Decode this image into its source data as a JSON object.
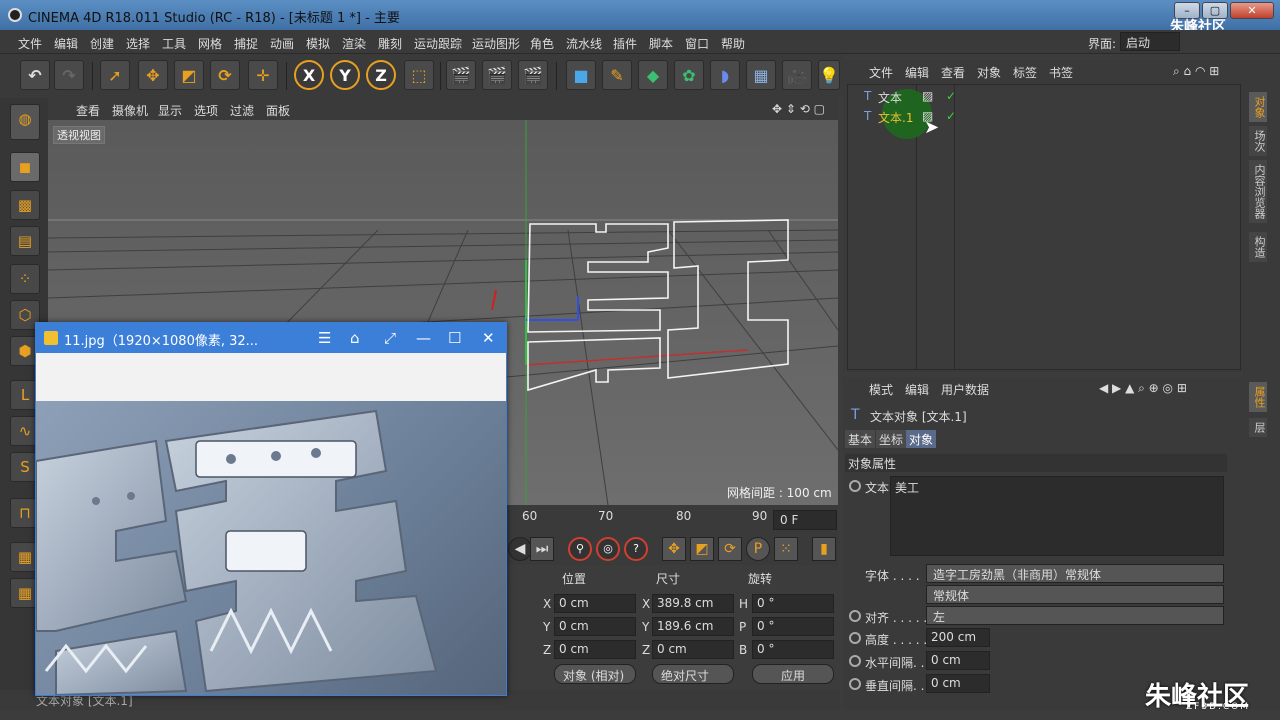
{
  "window": {
    "title": "CINEMA 4D R18.011 Studio (RC - R18) - [未标题 1 *] - 主要",
    "min": "–",
    "max": "▢",
    "close": "✕"
  },
  "menu": [
    "文件",
    "编辑",
    "创建",
    "选择",
    "工具",
    "网格",
    "捕捉",
    "动画",
    "模拟",
    "渲染",
    "雕刻",
    "运动跟踪",
    "运动图形",
    "角色",
    "流水线",
    "插件",
    "脚本",
    "窗口",
    "帮助"
  ],
  "layout": {
    "label": "界面:",
    "value": "启动"
  },
  "toolbar": {
    "x": "X",
    "y": "Y",
    "z": "Z"
  },
  "viewport": {
    "menu": [
      "查看",
      "摄像机",
      "显示",
      "选项",
      "过滤",
      "面板"
    ],
    "label": "透视视图",
    "grid_spacing": "网格间距 : 100 cm"
  },
  "timeline": {
    "ticks": [
      "60",
      "70",
      "80",
      "90"
    ],
    "frame": "0 F"
  },
  "coords": {
    "headers": {
      "pos": "位置",
      "size": "尺寸",
      "rot": "旋转"
    },
    "rows": [
      {
        "a": "X",
        "pos": "0 cm",
        "b": "X",
        "size": "389.8 cm",
        "c": "H",
        "rot": "0 °"
      },
      {
        "a": "Y",
        "pos": "0 cm",
        "b": "Y",
        "size": "189.6 cm",
        "c": "P",
        "rot": "0 °"
      },
      {
        "a": "Z",
        "pos": "0 cm",
        "b": "Z",
        "size": "0 cm",
        "c": "B",
        "rot": "0 °"
      }
    ],
    "mode": "对象 (相对)",
    "size_mode": "绝对尺寸",
    "apply": "应用"
  },
  "status": "文本对象 [文本.1]",
  "objects": {
    "menu": [
      "文件",
      "编辑",
      "查看",
      "对象",
      "标签",
      "书签"
    ],
    "items": [
      {
        "name": "文本",
        "check": "✓"
      },
      {
        "name": "文本.1",
        "check": "✓"
      }
    ]
  },
  "attributes": {
    "menu": [
      "模式",
      "编辑",
      "用户数据"
    ],
    "object_title": "文本对象 [文本.1]",
    "tabs": [
      "基本",
      "坐标",
      "对象"
    ],
    "section": "对象属性",
    "text_label": "文本",
    "text_value": "美工",
    "font_label": "字体 . . . .",
    "font_value": "造字工房劲黑（非商用）常规体",
    "font_style": "常规体",
    "align_label": "对齐 . . . . .",
    "align_value": "左",
    "height_label": "高度 . . . . .",
    "height_value": "200 cm",
    "hspace_label": "水平间隔. .",
    "hspace_value": "0 cm",
    "vspace_label": "垂直间隔. .",
    "vspace_value": "0 cm"
  },
  "right_tabs": [
    "对象",
    "场次",
    "内容浏览器",
    "构造"
  ],
  "right_tabs2": [
    "属性",
    "层"
  ],
  "image_viewer": {
    "title": "11.jpg（1920×1080像素, 32...",
    "menu": "☰",
    "close": "✕"
  },
  "watermark": {
    "brand": "朱峰社区",
    "url": "ZF3D.COM"
  }
}
